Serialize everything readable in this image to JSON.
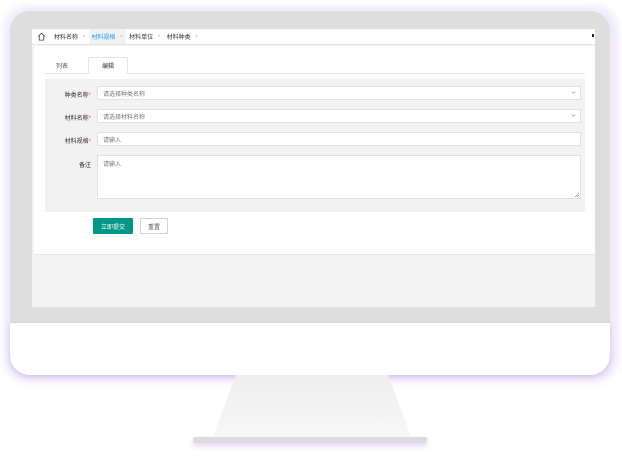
{
  "tabs": [
    {
      "label": "材料名称",
      "close": "×",
      "active": false
    },
    {
      "label": "材料规格",
      "close": "×",
      "active": true
    },
    {
      "label": "材料单位",
      "close": "×",
      "active": false
    },
    {
      "label": "材料种类",
      "close": "×",
      "active": false
    }
  ],
  "subtabs": {
    "list": "列表",
    "edit": "编辑"
  },
  "form": {
    "category": {
      "label": "种类名称",
      "required": "*",
      "placeholder": "请选择种类名称"
    },
    "material": {
      "label": "材料名称",
      "required": "*",
      "placeholder": "请选择材料名称"
    },
    "spec": {
      "label": "材料规格",
      "required": "*",
      "placeholder": "请输入"
    },
    "remark": {
      "label": "备注",
      "placeholder": "请输入"
    }
  },
  "buttons": {
    "submit": "立即提交",
    "reset": "重置"
  },
  "colors": {
    "primary": "#009688",
    "active_tab": "#1e9fff",
    "required": "#ff5722"
  }
}
